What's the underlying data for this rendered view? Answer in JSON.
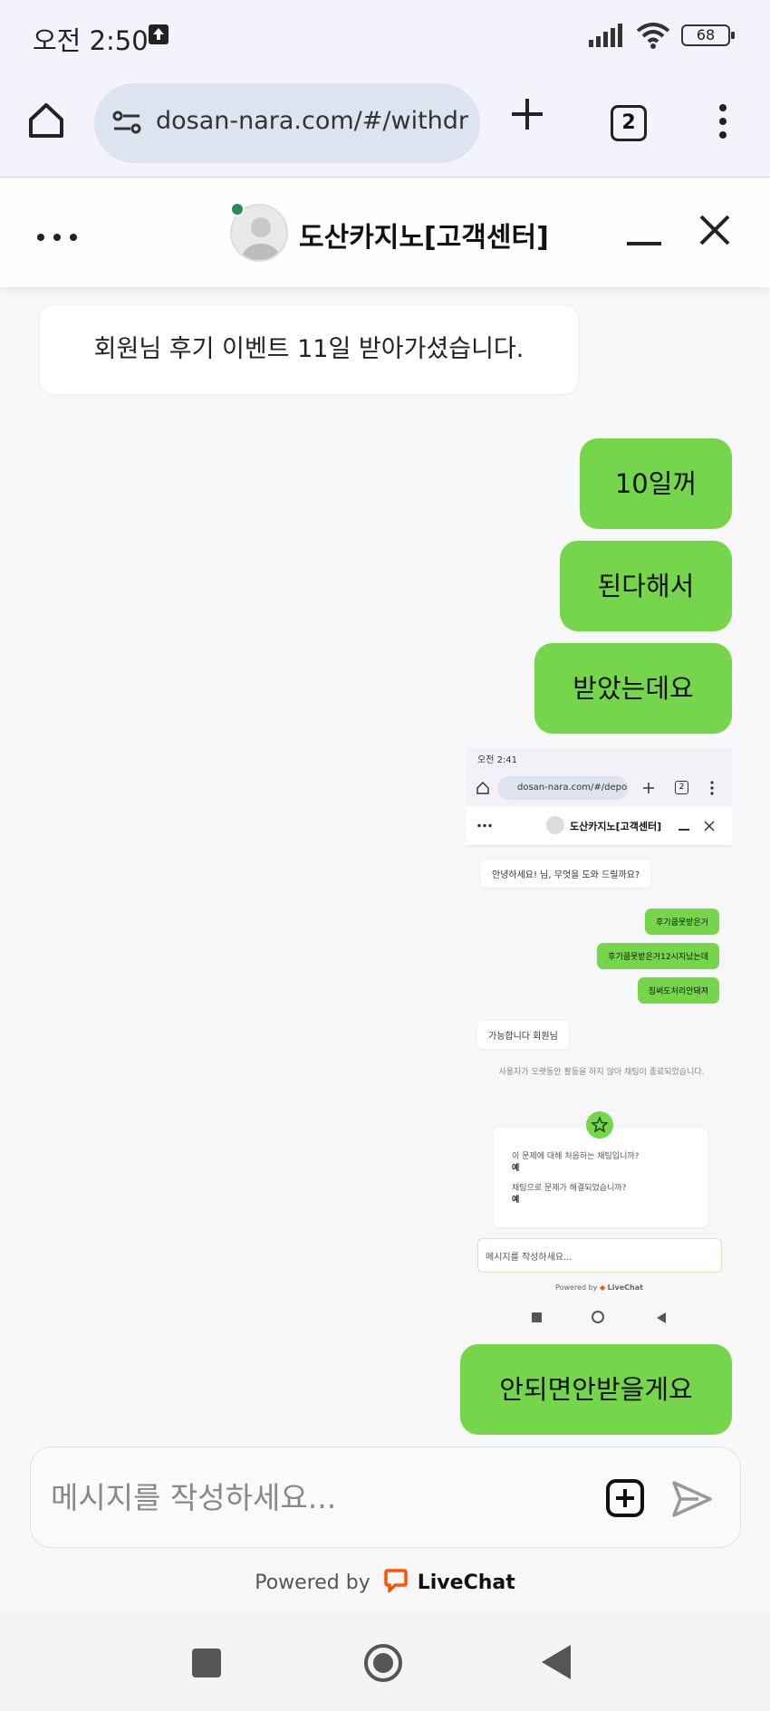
{
  "status_bar": {
    "time": "오전 2:50",
    "battery": "68"
  },
  "browser": {
    "url": "dosan-nara.com/#/withdra",
    "tab_count": "2"
  },
  "chat": {
    "title": "도산카지노[고객센터]",
    "messages": {
      "agent_1": "회원님 후기 이벤트 11일 받아가셨습니다.",
      "user_1": "10일꺼",
      "user_2": "된다해서",
      "user_3": "받았는데요",
      "user_4": "안되면안받을게요"
    },
    "attachment": {
      "status_time": "오전 2:41",
      "url": "dosan-nara.com/#/deposit",
      "tab_count": "2",
      "title": "도산카지노[고객센터]",
      "greeting": "안녕하세요! 님, 무엇을 도와 드릴까요?",
      "user_msgs": [
        "후기쿱못받은거",
        "후기쿱못받은거12시지났는데",
        "짐써도처리안돼져"
      ],
      "agent_reply": "가능합니다 회원님",
      "system_note": "사용자가 오랫동안 활동을 하지 않아 채팅이 종료되었습니다.",
      "survey_q1": "이 문제에 대해 처음하는 채팅입니까?",
      "survey_a1": "예",
      "survey_q2": "채팅으로 문제가 해결되었습니까?",
      "survey_a2": "예",
      "input_placeholder": "메시지를 작성하세요...",
      "powered_by": "Powered by",
      "brand": "LiveChat"
    }
  },
  "composer": {
    "placeholder": "메시지를 작성하세요..."
  },
  "footer": {
    "powered_by": "Powered by",
    "brand": "LiveChat"
  },
  "colors": {
    "user_bubble": "#76d64b",
    "online_dot": "#2e8b57",
    "livechat_brand": "#ff5100"
  },
  "icons": [
    "home-icon",
    "site-settings-icon",
    "plus-icon",
    "tab-switcher-icon",
    "more-vert-icon",
    "more-horiz-icon",
    "minimize-icon",
    "close-icon",
    "attach-icon",
    "send-icon",
    "livechat-logo-icon",
    "nav-recents-icon",
    "nav-home-icon",
    "nav-back-icon"
  ]
}
